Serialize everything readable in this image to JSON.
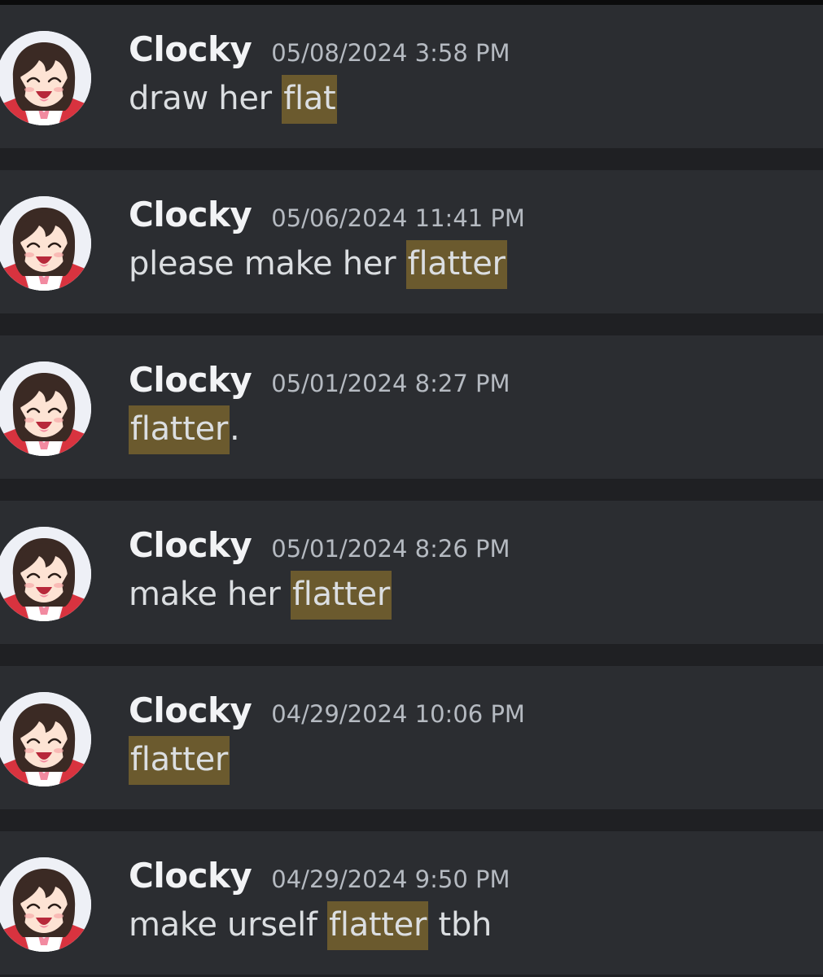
{
  "messages": [
    {
      "username": "Clocky",
      "timestamp": "05/08/2024 3:58 PM",
      "before": "draw her ",
      "highlight": "flat",
      "after": ""
    },
    {
      "username": "Clocky",
      "timestamp": "05/06/2024 11:41 PM",
      "before": "please make her ",
      "highlight": "flatter",
      "after": ""
    },
    {
      "username": "Clocky",
      "timestamp": "05/01/2024 8:27 PM",
      "before": "",
      "highlight": "flatter",
      "after": "."
    },
    {
      "username": "Clocky",
      "timestamp": "05/01/2024 8:26 PM",
      "before": "make her ",
      "highlight": "flatter",
      "after": ""
    },
    {
      "username": "Clocky",
      "timestamp": "04/29/2024 10:06 PM",
      "before": "",
      "highlight": "flatter",
      "after": ""
    },
    {
      "username": "Clocky",
      "timestamp": "04/29/2024 9:50 PM",
      "before": "make urself ",
      "highlight": "flatter",
      "after": " tbh"
    }
  ],
  "colors": {
    "background": "#1f2023",
    "card": "#2b2d31",
    "username": "#f2f3f5",
    "timestamp": "#b5bac1",
    "message_text": "#dbdee1",
    "search_highlight": "#6b5a2e"
  },
  "icons": {
    "avatar": "anime-girl-avatar-icon"
  }
}
